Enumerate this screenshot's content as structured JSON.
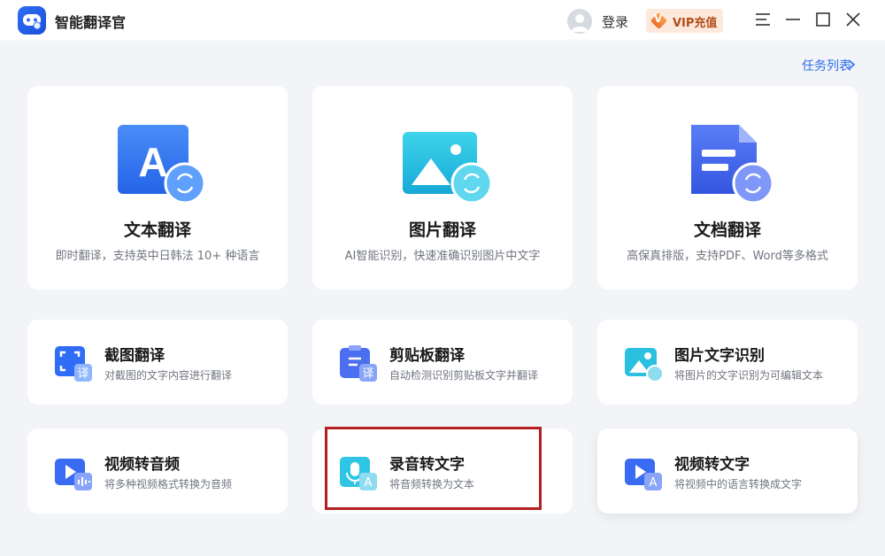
{
  "app": {
    "title": "智能翻译官"
  },
  "header": {
    "login_label": "登录",
    "vip_badge_letter": "V",
    "vip_label": "VIP充值"
  },
  "main": {
    "task_link": "任务列表",
    "big_cards": [
      {
        "title": "文本翻译",
        "desc": "即时翻译，支持英中日韩法 10+ 种语言",
        "icon": "text-translate-icon",
        "icon_letter": "A"
      },
      {
        "title": "图片翻译",
        "desc": "AI智能识别，快速准确识别图片中文字",
        "icon": "image-translate-icon"
      },
      {
        "title": "文档翻译",
        "desc": "高保真排版，支持PDF、Word等多格式",
        "icon": "document-translate-icon"
      }
    ],
    "small_cards": [
      {
        "title": "截图翻译",
        "desc": "对截图的文字内容进行翻译",
        "icon": "screenshot-translate-icon",
        "badge": "译"
      },
      {
        "title": "剪贴板翻译",
        "desc": "自动检测识别剪贴板文字并翻译",
        "icon": "clipboard-translate-icon",
        "badge": "译"
      },
      {
        "title": "图片文字识别",
        "desc": "将图片的文字识别为可编辑文本",
        "icon": "image-ocr-icon"
      },
      {
        "title": "视频转音频",
        "desc": "将多种视频格式转换为音频",
        "icon": "video-to-audio-icon"
      },
      {
        "title": "录音转文字",
        "desc": "将音频转换为文本",
        "icon": "audio-to-text-icon",
        "badge": "A"
      },
      {
        "title": "视频转文字",
        "desc": "将视频中的语言转换成文字",
        "icon": "video-to-text-icon",
        "badge": "A"
      }
    ]
  },
  "colors": {
    "accent": "#2b6bee",
    "highlight_border": "#b41f1f",
    "background": "#f2f4f7"
  }
}
